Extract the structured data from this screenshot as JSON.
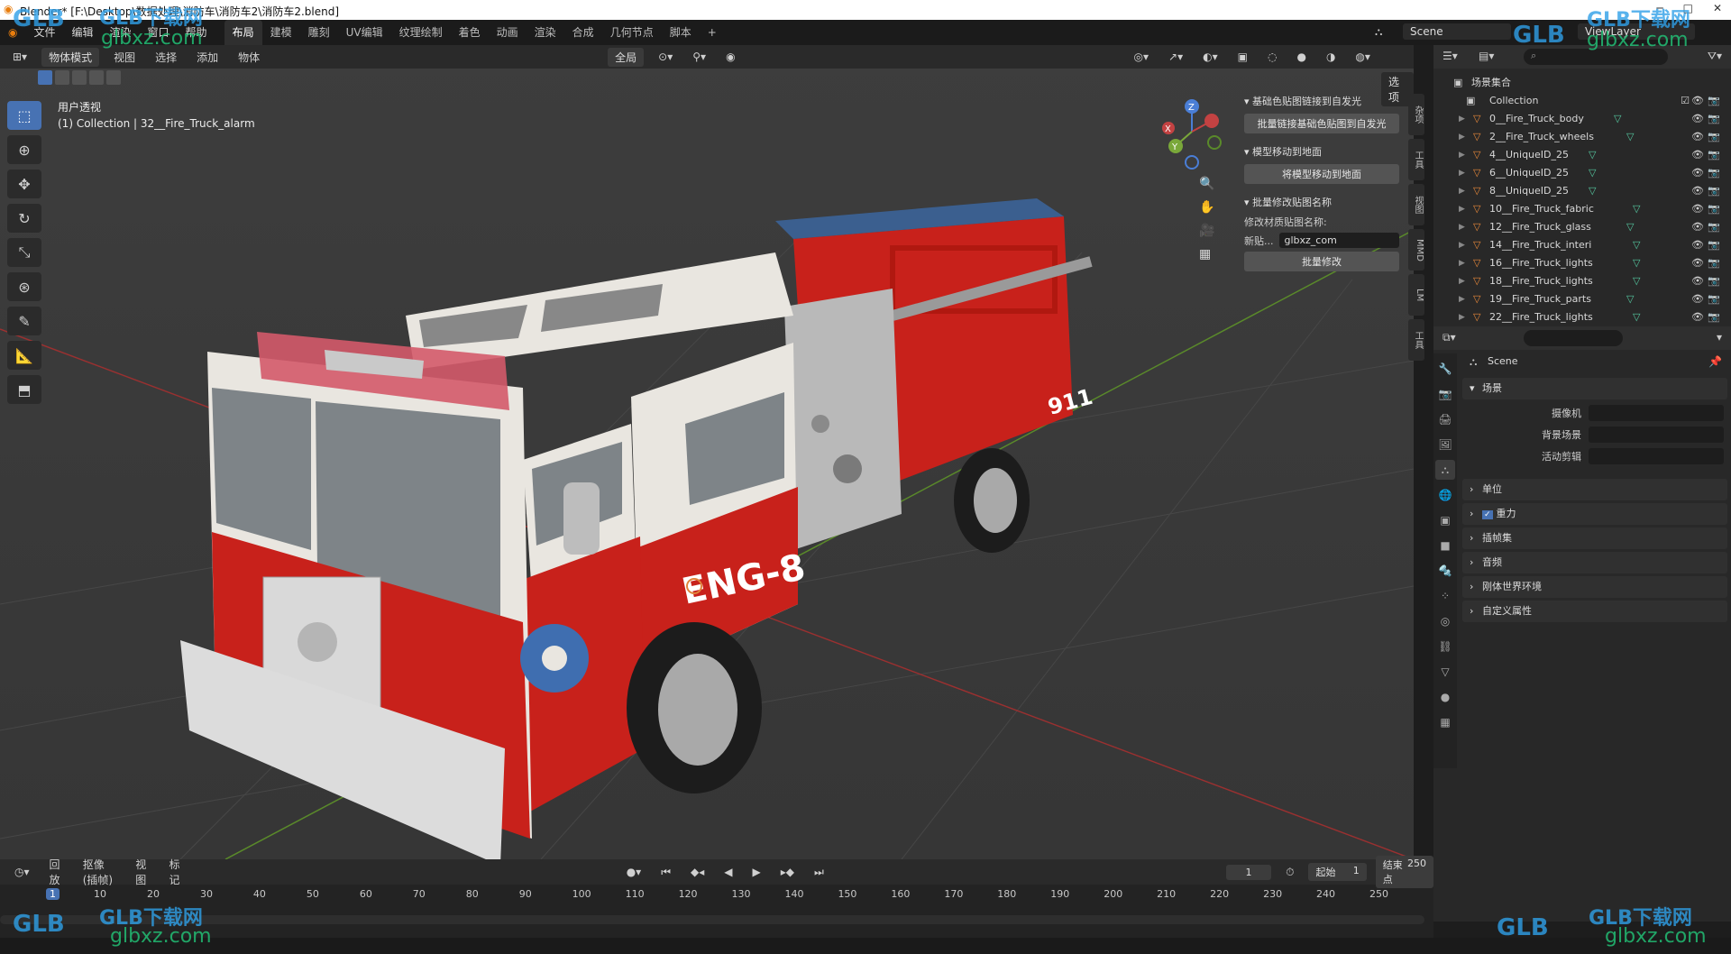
{
  "window": {
    "title": "Blender* [F:\\Desktop\\数据处理\\消防车\\消防车2\\消防车2.blend]"
  },
  "menu": {
    "items": [
      "文件",
      "编辑",
      "渲染",
      "窗口",
      "帮助"
    ],
    "workspaces": [
      "布局",
      "建模",
      "雕刻",
      "UV编辑",
      "纹理绘制",
      "着色",
      "动画",
      "渲染",
      "合成",
      "几何节点",
      "脚本"
    ],
    "active_workspace": "布局",
    "add_tab": "+",
    "scene": "Scene",
    "view_layer": "ViewLayer"
  },
  "viewport_header": {
    "mode": "物体模式",
    "menus": [
      "视图",
      "选择",
      "添加",
      "物体"
    ],
    "orientation": "全局",
    "options": "选项"
  },
  "viewport": {
    "overlay_line1": "用户透视",
    "overlay_line2": "(1) Collection | 32__Fire_Truck_alarm",
    "truck_text_1": "ENG-8",
    "truck_text_2": "911"
  },
  "n_panel": {
    "sec1_title": "基础色贴图链接到自发光",
    "sec1_button": "批量链接基础色贴图到自发光",
    "sec2_title": "模型移动到地面",
    "sec2_button": "将模型移动到地面",
    "sec3_title": "批量修改贴图名称",
    "sec3_label": "修改材质贴图名称:",
    "sec3_field_label": "新贴...",
    "sec3_field_value": "glbxz_com",
    "sec3_button": "批量修改",
    "tabs": [
      "杂项",
      "工具",
      "视图",
      "MMD",
      "LM",
      "工具"
    ]
  },
  "outliner": {
    "root": "场景集合",
    "collection": "Collection",
    "items": [
      "0__Fire_Truck_body",
      "2__Fire_Truck_wheels",
      "4__UniqueID_25",
      "6__UniqueID_25",
      "8__UniqueID_25",
      "10__Fire_Truck_fabric",
      "12__Fire_Truck_glass",
      "14__Fire_Truck_interi",
      "16__Fire_Truck_lights",
      "18__Fire_Truck_lights",
      "19__Fire_Truck_parts",
      "22__Fire_Truck_lights"
    ]
  },
  "properties": {
    "scene_name": "Scene",
    "section_scene": "场景",
    "camera_label": "摄像机",
    "bg_scene_label": "背景场景",
    "active_clip_label": "活动剪辑",
    "collapsed": [
      "单位",
      "重力",
      "插帧集",
      "音频",
      "刚体世界环境",
      "自定义属性"
    ]
  },
  "timeline": {
    "playback": "回放",
    "keying": "抠像(插帧)",
    "view": "视图",
    "marker": "标记",
    "current_frame": "1",
    "start_label": "起始",
    "start_value": "1",
    "end_label": "结束点",
    "end_value": "250",
    "ticks": [
      "1",
      "10",
      "20",
      "30",
      "40",
      "50",
      "60",
      "70",
      "80",
      "90",
      "100",
      "110",
      "120",
      "130",
      "140",
      "150",
      "160",
      "170",
      "180",
      "190",
      "200",
      "210",
      "220",
      "230",
      "240",
      "250"
    ]
  },
  "watermark": {
    "brand": "GLB下载网",
    "site": "glbxz.com",
    "logo": "GLB"
  },
  "colors": {
    "accent": "#4772b3",
    "truck_red": "#c8211b",
    "truck_white": "#e9e6e0",
    "grid_red": "#9b3030",
    "grid_green": "#5a8a2a"
  }
}
